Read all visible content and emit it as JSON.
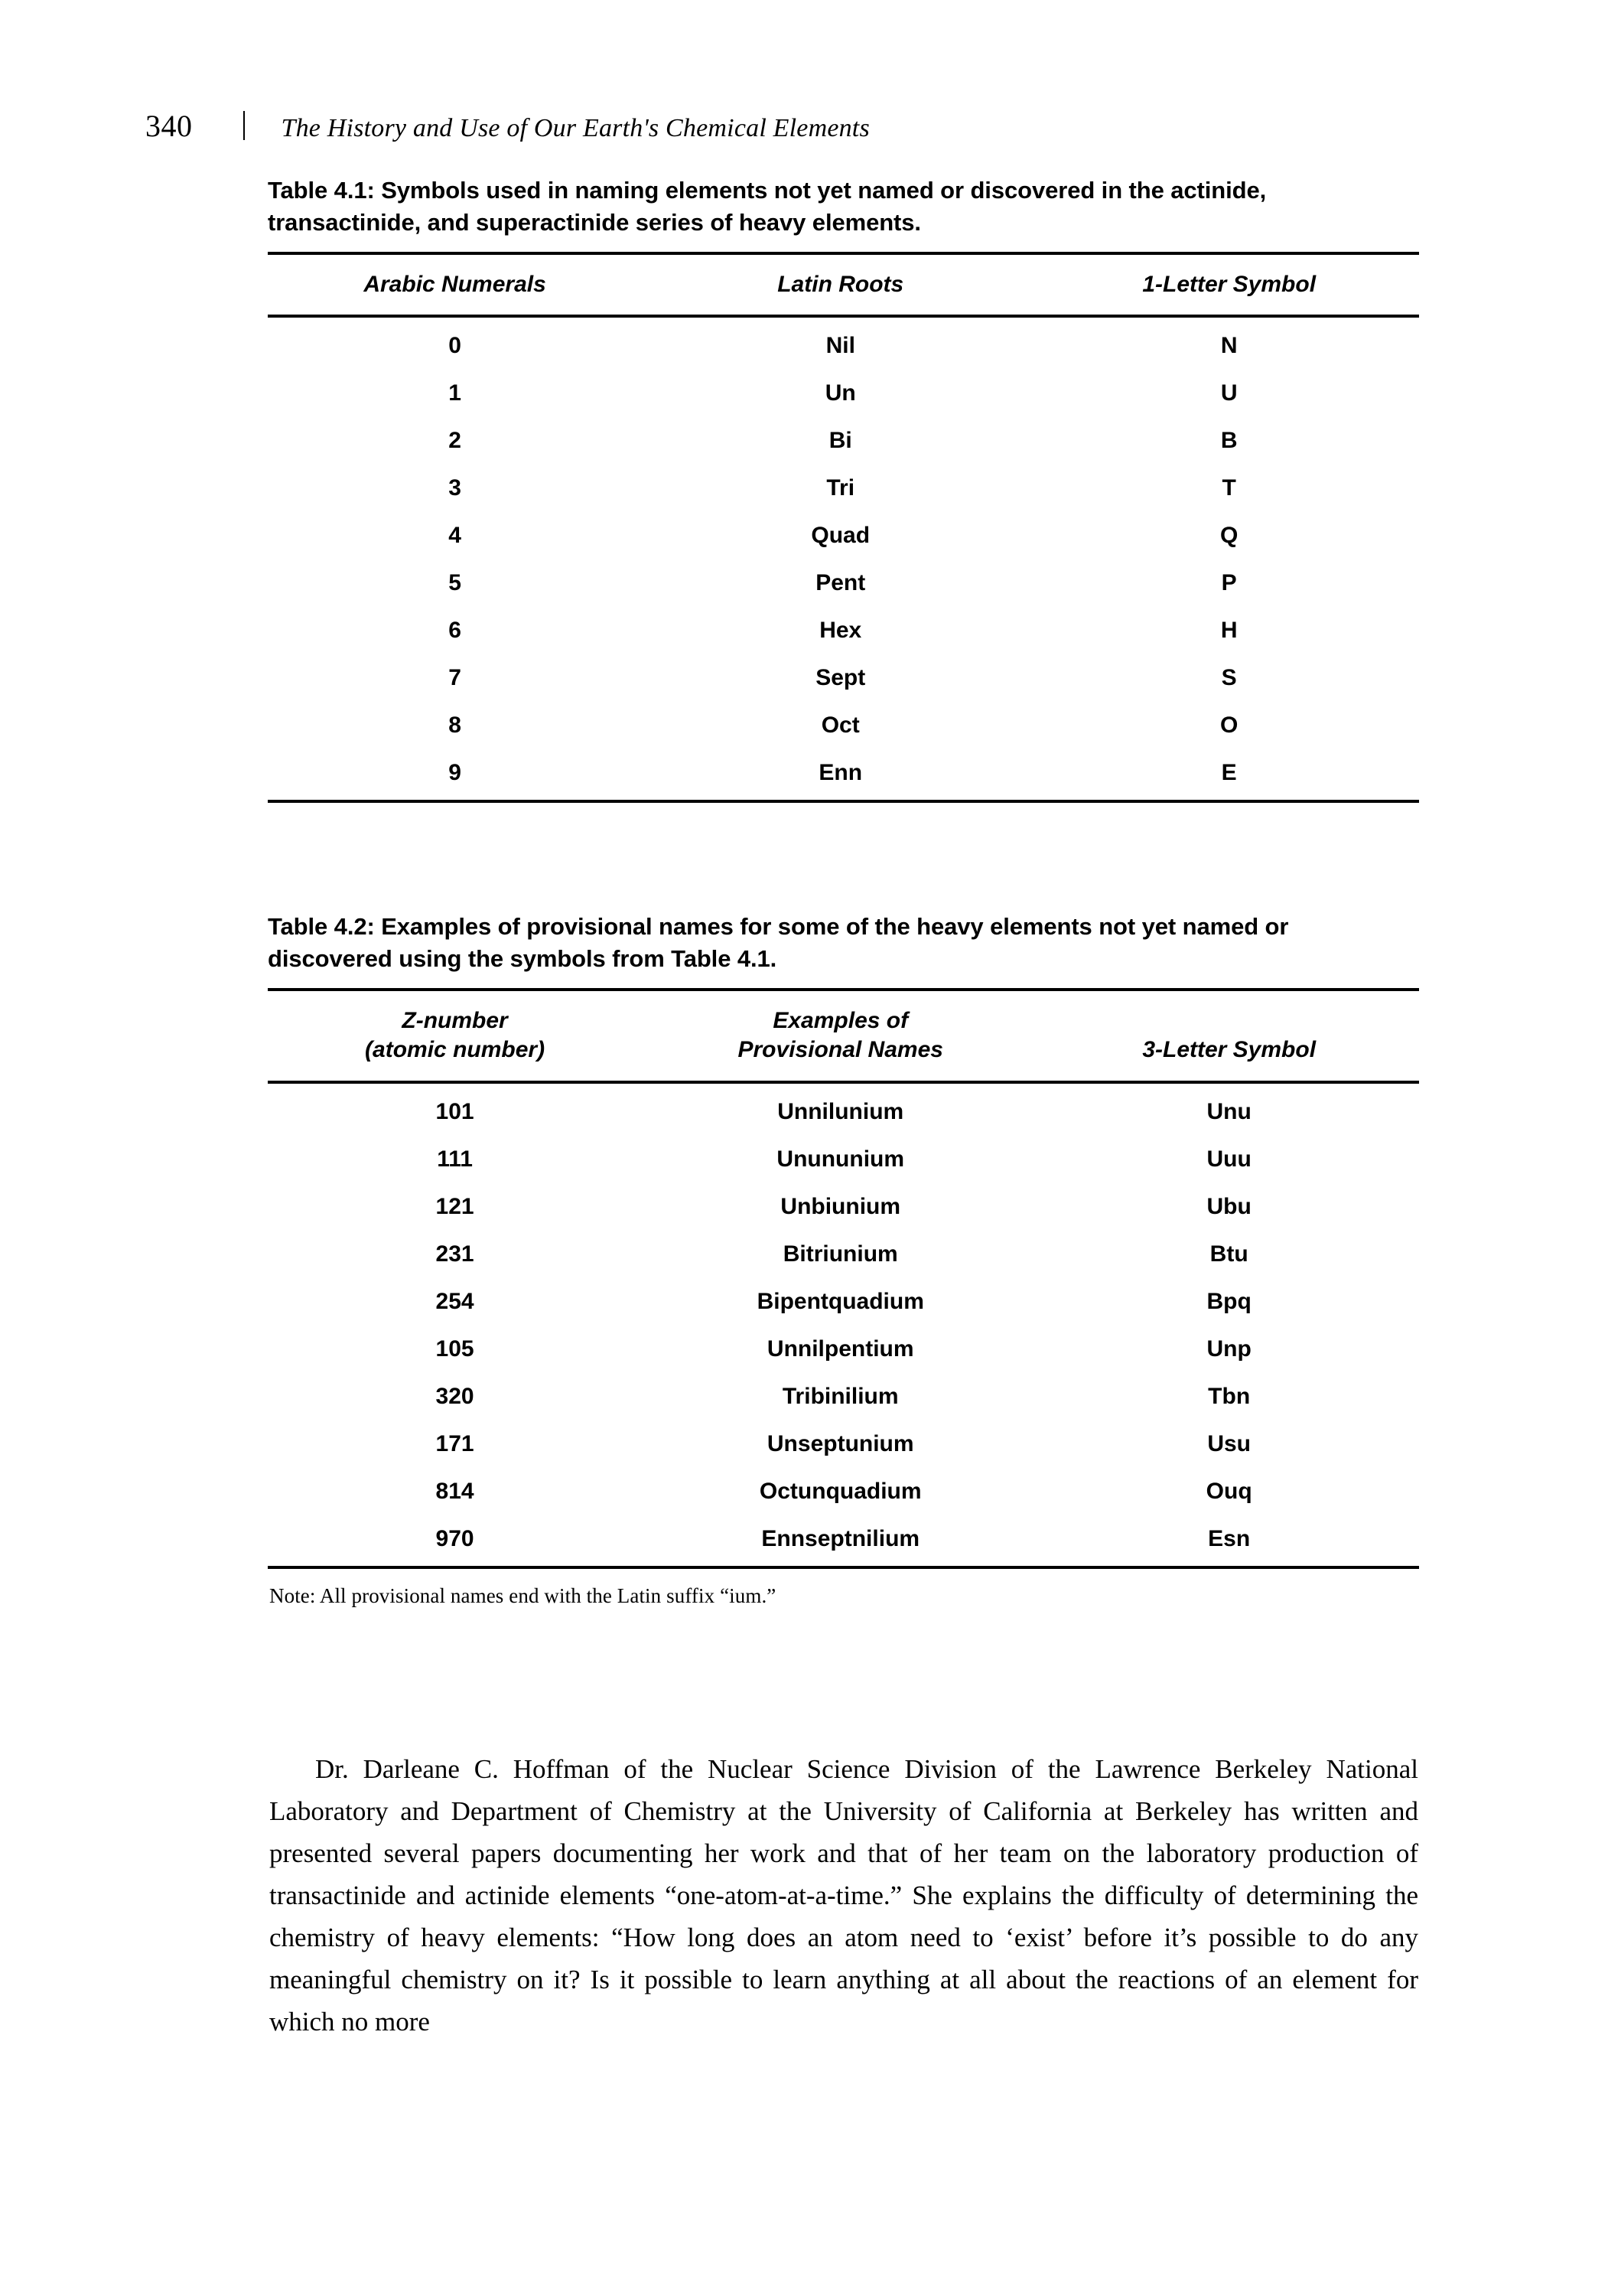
{
  "header": {
    "folio": "340",
    "book_title": "The History and Use of Our Earth's Chemical Elements"
  },
  "table_4_1": {
    "caption": "Table 4.1: Symbols used in naming elements not yet named or discovered in the actinide, transactinide, and superactinide series of heavy elements.",
    "columns": [
      "Arabic Numerals",
      "Latin Roots",
      "1-Letter Symbol"
    ],
    "rows": [
      {
        "numeral": "0",
        "root": "Nil",
        "symbol": "N"
      },
      {
        "numeral": "1",
        "root": "Un",
        "symbol": "U"
      },
      {
        "numeral": "2",
        "root": "Bi",
        "symbol": "B"
      },
      {
        "numeral": "3",
        "root": "Tri",
        "symbol": "T"
      },
      {
        "numeral": "4",
        "root": "Quad",
        "symbol": "Q"
      },
      {
        "numeral": "5",
        "root": "Pent",
        "symbol": "P"
      },
      {
        "numeral": "6",
        "root": "Hex",
        "symbol": "H"
      },
      {
        "numeral": "7",
        "root": "Sept",
        "symbol": "S"
      },
      {
        "numeral": "8",
        "root": "Oct",
        "symbol": "O"
      },
      {
        "numeral": "9",
        "root": "Enn",
        "symbol": "E"
      }
    ]
  },
  "table_4_2": {
    "caption": "Table 4.2: Examples of provisional names for some of the heavy elements not yet named or discovered using the symbols from Table 4.1.",
    "columns": [
      "Z-number\n(atomic number)",
      "Examples of\nProvisional Names",
      "3-Letter Symbol"
    ],
    "rows": [
      {
        "z": "101",
        "name": "Unnilunium",
        "symbol": "Unu"
      },
      {
        "z": "111",
        "name": "Unununium",
        "symbol": "Uuu"
      },
      {
        "z": "121",
        "name": "Unbiunium",
        "symbol": "Ubu"
      },
      {
        "z": "231",
        "name": "Bitriunium",
        "symbol": "Btu"
      },
      {
        "z": "254",
        "name": "Bipentquadium",
        "symbol": "Bpq"
      },
      {
        "z": "105",
        "name": "Unnilpentium",
        "symbol": "Unp"
      },
      {
        "z": "320",
        "name": "Tribinilium",
        "symbol": "Tbn"
      },
      {
        "z": "171",
        "name": "Unseptunium",
        "symbol": "Usu"
      },
      {
        "z": "814",
        "name": "Octunquadium",
        "symbol": "Ouq"
      },
      {
        "z": "970",
        "name": "Ennseptnilium",
        "symbol": "Esn"
      }
    ],
    "note": "Note: All provisional names end with the Latin suffix “ium.”"
  },
  "body": {
    "paragraph": "Dr. Darleane C. Hoffman of the Nuclear Science Division of the Lawrence Berkeley National Laboratory and Department of Chemistry at the University of California at Berkeley has written and presented several papers documenting her work and that of her team on the laboratory production of transactinide and actinide elements “one-atom-at-a-time.” She explains the difficulty of determining the chemistry of heavy elements: “How long does an atom need to ‘exist’ before it’s possible to do any meaningful chemistry on it? Is it possible to learn anything at all about the reactions of an element for which no more"
  }
}
